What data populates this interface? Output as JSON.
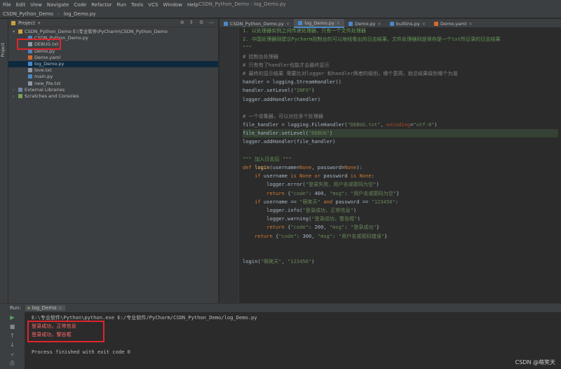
{
  "window": {
    "title": "CSDN_Python_Demo - log_Demo.py"
  },
  "menu": [
    "File",
    "Edit",
    "View",
    "Navigate",
    "Code",
    "Refactor",
    "Run",
    "Tools",
    "VCS",
    "Window",
    "Help"
  ],
  "breadcrumbs": [
    "CSDN_Python_Demo",
    "log_Demo.py"
  ],
  "project_panel": {
    "title": "Project",
    "tree": [
      {
        "label": "CSDN_Python_Demo E:\\专业软件\\PyCharm\\CSDN_Python_Demo",
        "icon": "folder",
        "indent": 0
      },
      {
        "label": "CSDN_Python_Demo.py",
        "icon": "file-py",
        "indent": 1
      },
      {
        "label": "DEBUG.txt",
        "icon": "file-txt",
        "indent": 1
      },
      {
        "label": "Demo.py",
        "icon": "file-py",
        "indent": 1
      },
      {
        "label": "Demo.yaml",
        "icon": "file-yml",
        "indent": 1
      },
      {
        "label": "log_Demo.py",
        "icon": "file-py",
        "indent": 1,
        "selected": true
      },
      {
        "label": "love.txt",
        "icon": "file-txt",
        "indent": 1
      },
      {
        "label": "main.py",
        "icon": "file-py",
        "indent": 1
      },
      {
        "label": "new_file.txt",
        "icon": "file-txt",
        "indent": 1
      },
      {
        "label": "External Libraries",
        "icon": "lib",
        "indent": 0
      },
      {
        "label": "Scratches and Consoles",
        "icon": "scr",
        "indent": 0
      }
    ]
  },
  "tabs": [
    {
      "label": "CSDN_Python_Demo.py",
      "active": false
    },
    {
      "label": "log_Demo.py",
      "active": true
    },
    {
      "label": "Demo.py",
      "active": false
    },
    {
      "label": "builtins.py",
      "active": false
    },
    {
      "label": "Demo.yaml",
      "active": false
    }
  ],
  "code": [
    [
      [
        "doc",
        "1. 以处理器实例之间传递处理器，只有一个文件处理器"
      ]
    ],
    [
      [
        "doc",
        "2. 中国处理器刚建议Pycharm控制台的可以地线看出的日志结果，文件处理器则是保存是一个txt所记录的日志结果"
      ]
    ],
    [
      [
        "doc",
        "\"\"\""
      ]
    ],
    [
      [
        "cmt",
        "# 控制台处理器"
      ]
    ],
    [
      [
        "cmt",
        "# 只有有了handler也能才会最终显示"
      ]
    ],
    [
      [
        "cmt",
        "# 最终的显示结果 需要比对logger 和handler两者的级别，哪个更高，就总结果级别哪个为准"
      ]
    ],
    [
      [
        "",
        "handler = logging.StreamHandler()"
      ]
    ],
    [
      [
        "",
        "handler.setLevel("
      ],
      [
        "str",
        "\"INFO\""
      ],
      [
        "",
        ")"
      ]
    ],
    [
      [
        "",
        "logger.addHandler(handler)"
      ]
    ],
    [
      [
        "",
        ""
      ]
    ],
    [
      [
        "cmt",
        "# 一个收集器，可以对应多个处理器"
      ]
    ],
    [
      [
        "",
        "file_handler = logging.FileHandler("
      ],
      [
        "str",
        "\"DEBUG.txt\""
      ],
      [
        "",
        ", "
      ],
      [
        "kwarg",
        "encoding"
      ],
      [
        "",
        "="
      ],
      [
        "str",
        "\"utf-8\""
      ],
      [
        "",
        ")"
      ]
    ],
    [
      [
        "",
        "file_handler.setLevel("
      ],
      [
        "str",
        "\"DEBUG\""
      ],
      [
        "",
        ")"
      ]
    ],
    [
      [
        "",
        "logger.addHandler(file_handler)"
      ]
    ],
    [
      [
        "",
        ""
      ]
    ],
    [
      [
        "doc",
        "\"\"\" 加入日志后 \"\"\""
      ]
    ],
    [
      [
        "kw",
        "def "
      ],
      [
        "fn",
        "login"
      ],
      [
        "",
        "(username="
      ],
      [
        "kw",
        "None"
      ],
      [
        "",
        ", password="
      ],
      [
        "kw",
        "None"
      ],
      [
        "",
        "):"
      ]
    ],
    [
      [
        "",
        "    "
      ],
      [
        "kw",
        "if "
      ],
      [
        "",
        "username "
      ],
      [
        "kw",
        "is None or "
      ],
      [
        "",
        "password "
      ],
      [
        "kw",
        "is None"
      ],
      [
        "",
        ":"
      ]
    ],
    [
      [
        "",
        "        logger.error("
      ],
      [
        "str",
        "\"登录失败，用户名或密码为空\""
      ],
      [
        "",
        ")"
      ]
    ],
    [
      [
        "",
        "        "
      ],
      [
        "kw",
        "return "
      ],
      [
        "",
        "{"
      ],
      [
        "str",
        "\"code\""
      ],
      [
        "",
        ": 400, "
      ],
      [
        "str",
        "\"msg\""
      ],
      [
        "",
        ": "
      ],
      [
        "str",
        "\"用户名或密码为空\""
      ],
      [
        "",
        "}"
      ]
    ],
    [
      [
        "",
        "    "
      ],
      [
        "kw",
        "if "
      ],
      [
        "",
        "username == "
      ],
      [
        "str",
        "\"萌笑天\""
      ],
      [
        "kw",
        " and "
      ],
      [
        "",
        "password == "
      ],
      [
        "str",
        "\"123456\""
      ],
      [
        "",
        ":"
      ]
    ],
    [
      [
        "",
        "        logger.info("
      ],
      [
        "str",
        "\"登录成功，正常信息\""
      ],
      [
        "",
        ")"
      ]
    ],
    [
      [
        "",
        "        logger.warning("
      ],
      [
        "str",
        "\"登录成功，警告框\""
      ],
      [
        "",
        ")"
      ]
    ],
    [
      [
        "",
        "        "
      ],
      [
        "kw",
        "return "
      ],
      [
        "",
        "{"
      ],
      [
        "str",
        "\"code\""
      ],
      [
        "",
        ": 200, "
      ],
      [
        "str",
        "\"msg\""
      ],
      [
        "",
        ": "
      ],
      [
        "str",
        "\"登录成功\""
      ],
      [
        "",
        "}"
      ]
    ],
    [
      [
        "",
        "    "
      ],
      [
        "kw",
        "return "
      ],
      [
        "",
        "{"
      ],
      [
        "str",
        "\"code\""
      ],
      [
        "",
        ": 300, "
      ],
      [
        "str",
        "\"msg\""
      ],
      [
        "",
        ": "
      ],
      [
        "str",
        "\"用户名或密码错误\""
      ],
      [
        "",
        "}"
      ]
    ],
    [
      [
        "",
        ""
      ]
    ],
    [
      [
        "",
        ""
      ]
    ],
    [
      [
        "",
        "login("
      ],
      [
        "str",
        "\"萌笑天\""
      ],
      [
        "",
        ", "
      ],
      [
        "str",
        "\"123456\""
      ],
      [
        "",
        ")"
      ]
    ]
  ],
  "run": {
    "header_label": "Run:",
    "config": "log_Demo",
    "lines": [
      {
        "text": "E:\\专业软件\\Python\\python.exe E:/专业软件/PyCharm/CSDN_Python_Demo/log_Demo.py",
        "kind": "normal"
      },
      {
        "text": "登录成功，正常信息",
        "kind": "err"
      },
      {
        "text": "登录成功，警告框",
        "kind": "err"
      },
      {
        "text": "",
        "kind": "normal"
      },
      {
        "text": "Process finished with exit code 0",
        "kind": "normal"
      }
    ]
  },
  "watermark": "CSDN @萌笑天",
  "colors": {
    "highlight_box": "#e0242c",
    "accent": "#4a88c7"
  }
}
